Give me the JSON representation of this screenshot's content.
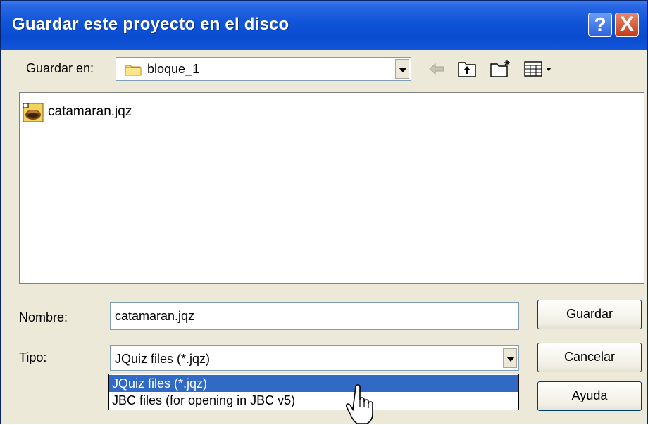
{
  "window": {
    "title": "Guardar este proyecto en el disco",
    "help_button": "?",
    "close_button": "X"
  },
  "location": {
    "label": "Guardar en:",
    "folder": "bloque_1",
    "toolbar_icons": [
      "back-icon",
      "up-folder-icon",
      "new-folder-icon",
      "view-menu-icon"
    ]
  },
  "files": [
    {
      "name": "catamaran.jqz",
      "icon": "jquiz-file-icon"
    }
  ],
  "filename": {
    "label": "Nombre:",
    "value": "catamaran.jqz"
  },
  "filetype": {
    "label": "Tipo:",
    "value": "JQuiz files (*.jqz)",
    "options": [
      "JQuiz files (*.jqz)",
      "JBC files (for opening in JBC v5)"
    ],
    "selected_index": 0
  },
  "buttons": {
    "save": "Guardar",
    "cancel": "Cancelar",
    "help": "Ayuda"
  },
  "colors": {
    "titlebar": "#0a4bd0",
    "selection": "#316ac5",
    "dialog_bg": "#ece9d8"
  }
}
